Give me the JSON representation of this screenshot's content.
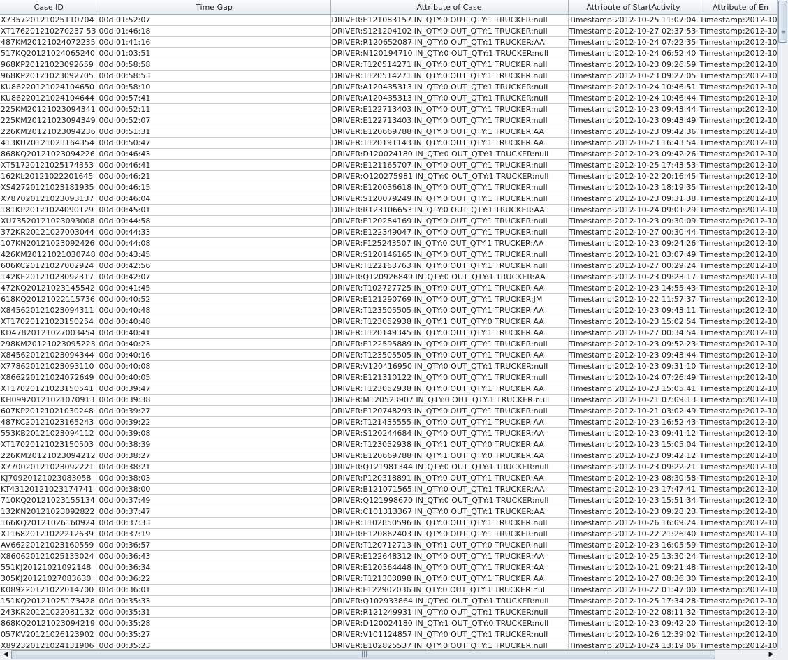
{
  "table": {
    "columns": [
      "Case ID",
      "Time Gap",
      "Attribute of Case",
      "Attribute of StartActivity",
      "Attribute of En"
    ],
    "rows": [
      [
        "X735720121025110704",
        "00d 01:52:07",
        "DRIVER:E121083157 IN_QTY:0 OUT_QTY:1 TRUCKER:null",
        "Timestamp:2012-10-25 11:07:04",
        "Timestamp:2012-10"
      ],
      [
        "XT176201210270237 53",
        "00d 01:46:18",
        "DRIVER:S121204102 IN_QTY:0 OUT_QTY:1 TRUCKER:null",
        "Timestamp:2012-10-27 02:37:53",
        "Timestamp:2012-10"
      ],
      [
        "487KM20121024072235",
        "00d 01:41:16",
        "DRIVER:R120652087 IN_QTY:0 OUT_QTY:1 TRUCKER:AA",
        "Timestamp:2012-10-24 07:22:35",
        "Timestamp:2012-10"
      ],
      [
        "517KQ20121024065240",
        "00d 01:03:51",
        "DRIVER:N120194710 IN_QTY:0 OUT_QTY:1 TRUCKER:null",
        "Timestamp:2012-10-24 06:52:40",
        "Timestamp:2012-10"
      ],
      [
        "968KP20121023092659",
        "00d 00:58:58",
        "DRIVER:T120514271 IN_QTY:0 OUT_QTY:1 TRUCKER:null",
        "Timestamp:2012-10-23 09:26:59",
        "Timestamp:2012-10"
      ],
      [
        "968KP20121023092705",
        "00d 00:58:53",
        "DRIVER:T120514271 IN_QTY:0 OUT_QTY:1 TRUCKER:null",
        "Timestamp:2012-10-23 09:27:05",
        "Timestamp:2012-10"
      ],
      [
        "KU86220121024104650",
        "00d 00:58:10",
        "DRIVER:A120435313 IN_QTY:0 OUT_QTY:1 TRUCKER:null",
        "Timestamp:2012-10-24 10:46:51",
        "Timestamp:2012-10"
      ],
      [
        "KU86220121024104644",
        "00d 00:57:41",
        "DRIVER:A120435313 IN_QTY:0 OUT_QTY:1 TRUCKER:null",
        "Timestamp:2012-10-24 10:46:44",
        "Timestamp:2012-10"
      ],
      [
        "225KM20121023094341",
        "00d 00:52:11",
        "DRIVER:E122713403 IN_QTY:0 OUT_QTY:1 TRUCKER:null",
        "Timestamp:2012-10-23 09:43:44",
        "Timestamp:2012-10"
      ],
      [
        "225KM20121023094349",
        "00d 00:52:07",
        "DRIVER:E122713403 IN_QTY:0 OUT_QTY:1 TRUCKER:null",
        "Timestamp:2012-10-23 09:43:49",
        "Timestamp:2012-10"
      ],
      [
        "226KM20121023094236",
        "00d 00:51:31",
        "DRIVER:E120669788 IN_QTY:0 OUT_QTY:1 TRUCKER:AA",
        "Timestamp:2012-10-23 09:42:36",
        "Timestamp:2012-10"
      ],
      [
        "413KU20121023164354",
        "00d 00:50:47",
        "DRIVER:T120191143 IN_QTY:0 OUT_QTY:1 TRUCKER:AA",
        "Timestamp:2012-10-23 16:43:54",
        "Timestamp:2012-10"
      ],
      [
        "868KQ20121023094226",
        "00d 00:46:43",
        "DRIVER:D120024180 IN_QTY:0 OUT_QTY:1 TRUCKER:null",
        "Timestamp:2012-10-23 09:42:26",
        "Timestamp:2012-10"
      ],
      [
        "XT51720121025174353",
        "00d 00:46:41",
        "DRIVER:E121165707 IN_QTY:0 OUT_QTY:1 TRUCKER:null",
        "Timestamp:2012-10-25 17:43:53",
        "Timestamp:2012-10"
      ],
      [
        "162KL20121022201645",
        "00d 00:46:21",
        "DRIVER:Q120275981 IN_QTY:0 OUT_QTY:1 TRUCKER:null",
        "Timestamp:2012-10-22 20:16:45",
        "Timestamp:2012-10"
      ],
      [
        "XS42720121023181935",
        "00d 00:46:15",
        "DRIVER:E120036618 IN_QTY:0 OUT_QTY:1 TRUCKER:null",
        "Timestamp:2012-10-23 18:19:35",
        "Timestamp:2012-10"
      ],
      [
        "X787020121023093137",
        "00d 00:46:04",
        "DRIVER:S120079249 IN_QTY:0 OUT_QTY:1 TRUCKER:null",
        "Timestamp:2012-10-23 09:31:38",
        "Timestamp:2012-10"
      ],
      [
        "181KP20121024090129",
        "00d 00:45:01",
        "DRIVER:R123106653 IN_QTY:0 OUT_QTY:1 TRUCKER:AA",
        "Timestamp:2012-10-24 09:01:29",
        "Timestamp:2012-10"
      ],
      [
        "XU73520121023093008",
        "00d 00:44:58",
        "DRIVER:E120284169 IN_QTY:0 OUT_QTY:1 TRUCKER:null",
        "Timestamp:2012-10-23 09:30:09",
        "Timestamp:2012-10"
      ],
      [
        "372KR20121027003044",
        "00d 00:44:33",
        "DRIVER:E122349047 IN_QTY:0 OUT_QTY:1 TRUCKER:null",
        "Timestamp:2012-10-27 00:30:44",
        "Timestamp:2012-10"
      ],
      [
        "107KN20121023092426",
        "00d 00:44:08",
        "DRIVER:F125243507 IN_QTY:0 OUT_QTY:1 TRUCKER:AA",
        "Timestamp:2012-10-23 09:24:26",
        "Timestamp:2012-10"
      ],
      [
        "426KM20121021030748",
        "00d 00:43:45",
        "DRIVER:S120146165 IN_QTY:0 OUT_QTY:1 TRUCKER:null",
        "Timestamp:2012-10-21 03:07:49",
        "Timestamp:2012-10"
      ],
      [
        "606KC20121027002924",
        "00d 00:42:56",
        "DRIVER:T122163763 IN_QTY:0 OUT_QTY:1 TRUCKER:null",
        "Timestamp:2012-10-27 00:29:24",
        "Timestamp:2012-10"
      ],
      [
        "142KE20121023092317",
        "00d 00:42:07",
        "DRIVER:Q120926849 IN_QTY:0 OUT_QTY:1 TRUCKER:AA",
        "Timestamp:2012-10-23 09:23:17",
        "Timestamp:2012-10"
      ],
      [
        "472KQ20121023145542",
        "00d 00:41:45",
        "DRIVER:T102727725 IN_QTY:0 OUT_QTY:1 TRUCKER:AA",
        "Timestamp:2012-10-23 14:55:43",
        "Timestamp:2012-10"
      ],
      [
        "618KQ20121022115736",
        "00d 00:40:52",
        "DRIVER:E121290769 IN_QTY:0 OUT_QTY:1 TRUCKER:JM",
        "Timestamp:2012-10-22 11:57:37",
        "Timestamp:2012-10"
      ],
      [
        "X845620121023094311",
        "00d 00:40:48",
        "DRIVER:T123505505 IN_QTY:0 OUT_QTY:1 TRUCKER:AA",
        "Timestamp:2012-10-23 09:43:11",
        "Timestamp:2012-10"
      ],
      [
        "XT17020121023150254",
        "00d 00:40:48",
        "DRIVER:T123052938 IN_QTY:1 OUT_QTY:0 TRUCKER:AA",
        "Timestamp:2012-10-23 15:02:54",
        "Timestamp:2012-10"
      ],
      [
        "KD47820121027003454",
        "00d 00:40:41",
        "DRIVER:T120149345 IN_QTY:0 OUT_QTY:1 TRUCKER:AA",
        "Timestamp:2012-10-27 00:34:54",
        "Timestamp:2012-10"
      ],
      [
        "298KM20121023095223",
        "00d 00:40:23",
        "DRIVER:E122595889 IN_QTY:0 OUT_QTY:1 TRUCKER:null",
        "Timestamp:2012-10-23 09:52:23",
        "Timestamp:2012-10"
      ],
      [
        "X845620121023094344",
        "00d 00:40:16",
        "DRIVER:T123505505 IN_QTY:0 OUT_QTY:1 TRUCKER:AA",
        "Timestamp:2012-10-23 09:43:44",
        "Timestamp:2012-10"
      ],
      [
        "X778620121023093110",
        "00d 00:40:08",
        "DRIVER:V120416950 IN_QTY:0 OUT_QTY:1 TRUCKER:null",
        "Timestamp:2012-10-23 09:31:10",
        "Timestamp:2012-10"
      ],
      [
        "X866220121024072649",
        "00d 00:40:05",
        "DRIVER:E121310122 IN_QTY:0 OUT_QTY:1 TRUCKER:null",
        "Timestamp:2012-10-24 07:26:49",
        "Timestamp:2012-10"
      ],
      [
        "XT17020121023150541",
        "00d 00:39:47",
        "DRIVER:T123052938 IN_QTY:0 OUT_QTY:1 TRUCKER:AA",
        "Timestamp:2012-10-23 15:05:41",
        "Timestamp:2012-10"
      ],
      [
        "KH09920121021070913",
        "00d 00:39:38",
        "DRIVER:M120523907 IN_QTY:0 OUT_QTY:1 TRUCKER:null",
        "Timestamp:2012-10-21 07:09:13",
        "Timestamp:2012-10"
      ],
      [
        "607KP20121021030248",
        "00d 00:39:27",
        "DRIVER:E120748293 IN_QTY:0 OUT_QTY:1 TRUCKER:null",
        "Timestamp:2012-10-21 03:02:49",
        "Timestamp:2012-10"
      ],
      [
        "487KC20121023165243",
        "00d 00:39:22",
        "DRIVER:T121435555 IN_QTY:0 OUT_QTY:1 TRUCKER:AA",
        "Timestamp:2012-10-23 16:52:43",
        "Timestamp:2012-10"
      ],
      [
        "553KB20121023094112",
        "00d 00:39:08",
        "DRIVER:S120244684 IN_QTY:0 OUT_QTY:1 TRUCKER:AA",
        "Timestamp:2012-10-23 09:41:12",
        "Timestamp:2012-10"
      ],
      [
        "XT17020121023150503",
        "00d 00:38:39",
        "DRIVER:T123052938 IN_QTY:1 OUT_QTY:0 TRUCKER:AA",
        "Timestamp:2012-10-23 15:05:04",
        "Timestamp:2012-10"
      ],
      [
        "226KM20121023094212",
        "00d 00:38:27",
        "DRIVER:E120669788 IN_QTY:1 OUT_QTY:0 TRUCKER:AA",
        "Timestamp:2012-10-23 09:42:12",
        "Timestamp:2012-10"
      ],
      [
        "X770020121023092221",
        "00d 00:38:21",
        "DRIVER:Q121981344 IN_QTY:0 OUT_QTY:1 TRUCKER:null",
        "Timestamp:2012-10-23 09:22:21",
        "Timestamp:2012-10"
      ],
      [
        "KJ70920121023083058",
        "00d 00:38:03",
        "DRIVER:P120318891 IN_QTY:0 OUT_QTY:1 TRUCKER:AA",
        "Timestamp:2012-10-23 08:30:58",
        "Timestamp:2012-10"
      ],
      [
        "KT43120121023174741",
        "00d 00:38:00",
        "DRIVER:B121071565 IN_QTY:0 OUT_QTY:1 TRUCKER:AA",
        "Timestamp:2012-10-23 17:47:41",
        "Timestamp:2012-10"
      ],
      [
        "710KQ20121023155134",
        "00d 00:37:49",
        "DRIVER:Q121998670 IN_QTY:0 OUT_QTY:1 TRUCKER:null",
        "Timestamp:2012-10-23 15:51:34",
        "Timestamp:2012-10"
      ],
      [
        "132KN20121023092822",
        "00d 00:37:47",
        "DRIVER:C101313367 IN_QTY:0 OUT_QTY:1 TRUCKER:AA",
        "Timestamp:2012-10-23 09:28:23",
        "Timestamp:2012-10"
      ],
      [
        "166KQ20121026160924",
        "00d 00:37:33",
        "DRIVER:T102850596 IN_QTY:0 OUT_QTY:1 TRUCKER:null",
        "Timestamp:2012-10-26 16:09:24",
        "Timestamp:2012-10"
      ],
      [
        "XT16820121022212639",
        "00d 00:37:19",
        "DRIVER:E120862403 IN_QTY:0 OUT_QTY:1 TRUCKER:null",
        "Timestamp:2012-10-22 21:26:40",
        "Timestamp:2012-10"
      ],
      [
        "AV66220121023160559",
        "00d 00:36:57",
        "DRIVER:T120712713 IN_QTY:1 OUT_QTY:0 TRUCKER:null",
        "Timestamp:2012-10-23 16:05:59",
        "Timestamp:2012-10"
      ],
      [
        "X860620121025133024",
        "00d 00:36:43",
        "DRIVER:E122648312 IN_QTY:0 OUT_QTY:1 TRUCKER:AA",
        "Timestamp:2012-10-25 13:30:24",
        "Timestamp:2012-10"
      ],
      [
        "551KJ20121021092148",
        "00d 00:36:34",
        "DRIVER:E120364448 IN_QTY:0 OUT_QTY:1 TRUCKER:AA",
        "Timestamp:2012-10-21 09:21:48",
        "Timestamp:2012-10"
      ],
      [
        "305KJ20121027083630",
        "00d 00:36:22",
        "DRIVER:T121303898 IN_QTY:0 OUT_QTY:1 TRUCKER:AA",
        "Timestamp:2012-10-27 08:36:30",
        "Timestamp:2012-10"
      ],
      [
        "K089220121022014700",
        "00d 00:36:01",
        "DRIVER:F122902036 IN_QTY:0 OUT_QTY:1 TRUCKER:null",
        "Timestamp:2012-10-22 01:47:00",
        "Timestamp:2012-10"
      ],
      [
        "151KQ20121025173428",
        "00d 00:35:33",
        "DRIVER:Q102933864 IN_QTY:0 OUT_QTY:1 TRUCKER:null",
        "Timestamp:2012-10-25 17:34:28",
        "Timestamp:2012-10"
      ],
      [
        "243KR20121022081132",
        "00d 00:35:31",
        "DRIVER:R121249931 IN_QTY:0 OUT_QTY:1 TRUCKER:null",
        "Timestamp:2012-10-22 08:11:32",
        "Timestamp:2012-10"
      ],
      [
        "868KQ20121023094219",
        "00d 00:35:28",
        "DRIVER:D120024180 IN_QTY:1 OUT_QTY:0 TRUCKER:null",
        "Timestamp:2012-10-23 09:42:20",
        "Timestamp:2012-10"
      ],
      [
        "057KV20121026123902",
        "00d 00:35:27",
        "DRIVER:V101124857 IN_QTY:0 OUT_QTY:1 TRUCKER:null",
        "Timestamp:2012-10-26 12:39:02",
        "Timestamp:2012-10"
      ],
      [
        "X892320121024131906",
        "00d 00:35:23",
        "DRIVER:E102825537 IN_QTY:0 OUT_QTY:1 TRUCKER:null",
        "Timestamp:2012-10-24 13:19:06",
        "Timestamp:2012-10"
      ]
    ]
  },
  "scrollbars": {
    "left_arrow": "◀",
    "right_arrow": "▶",
    "grip": "|||",
    "vgrip": "≡"
  }
}
